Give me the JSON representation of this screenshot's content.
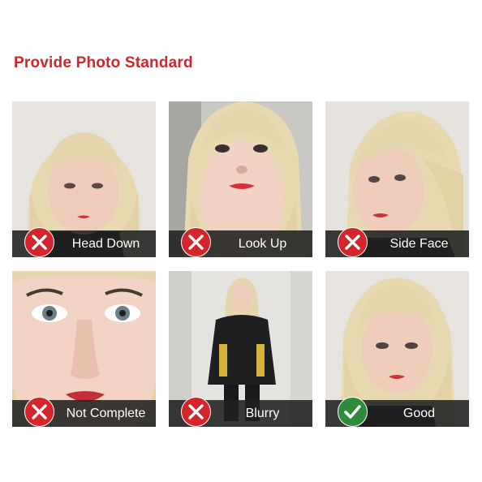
{
  "title": "Provide Photo Standard",
  "colors": {
    "title": "#d3252b",
    "bad_badge": "#d3252b",
    "good_badge": "#2e8b3c",
    "caption_bar": "#202020"
  },
  "cards": [
    {
      "label": "Head Down",
      "status": "bad",
      "badge_icon": "x-mark-icon",
      "photo": "head-tilted-down"
    },
    {
      "label": "Look Up",
      "status": "bad",
      "badge_icon": "x-mark-icon",
      "photo": "face-looking-up"
    },
    {
      "label": "Side Face",
      "status": "bad",
      "badge_icon": "x-mark-icon",
      "photo": "face-turned-sideways"
    },
    {
      "label": "Not Complete",
      "status": "bad",
      "badge_icon": "x-mark-icon",
      "photo": "face-cropped-closeup"
    },
    {
      "label": "Blurry",
      "status": "bad",
      "badge_icon": "x-mark-icon",
      "photo": "full-body-distant"
    },
    {
      "label": "Good",
      "status": "good",
      "badge_icon": "check-mark-icon",
      "photo": "front-facing-portrait"
    }
  ]
}
